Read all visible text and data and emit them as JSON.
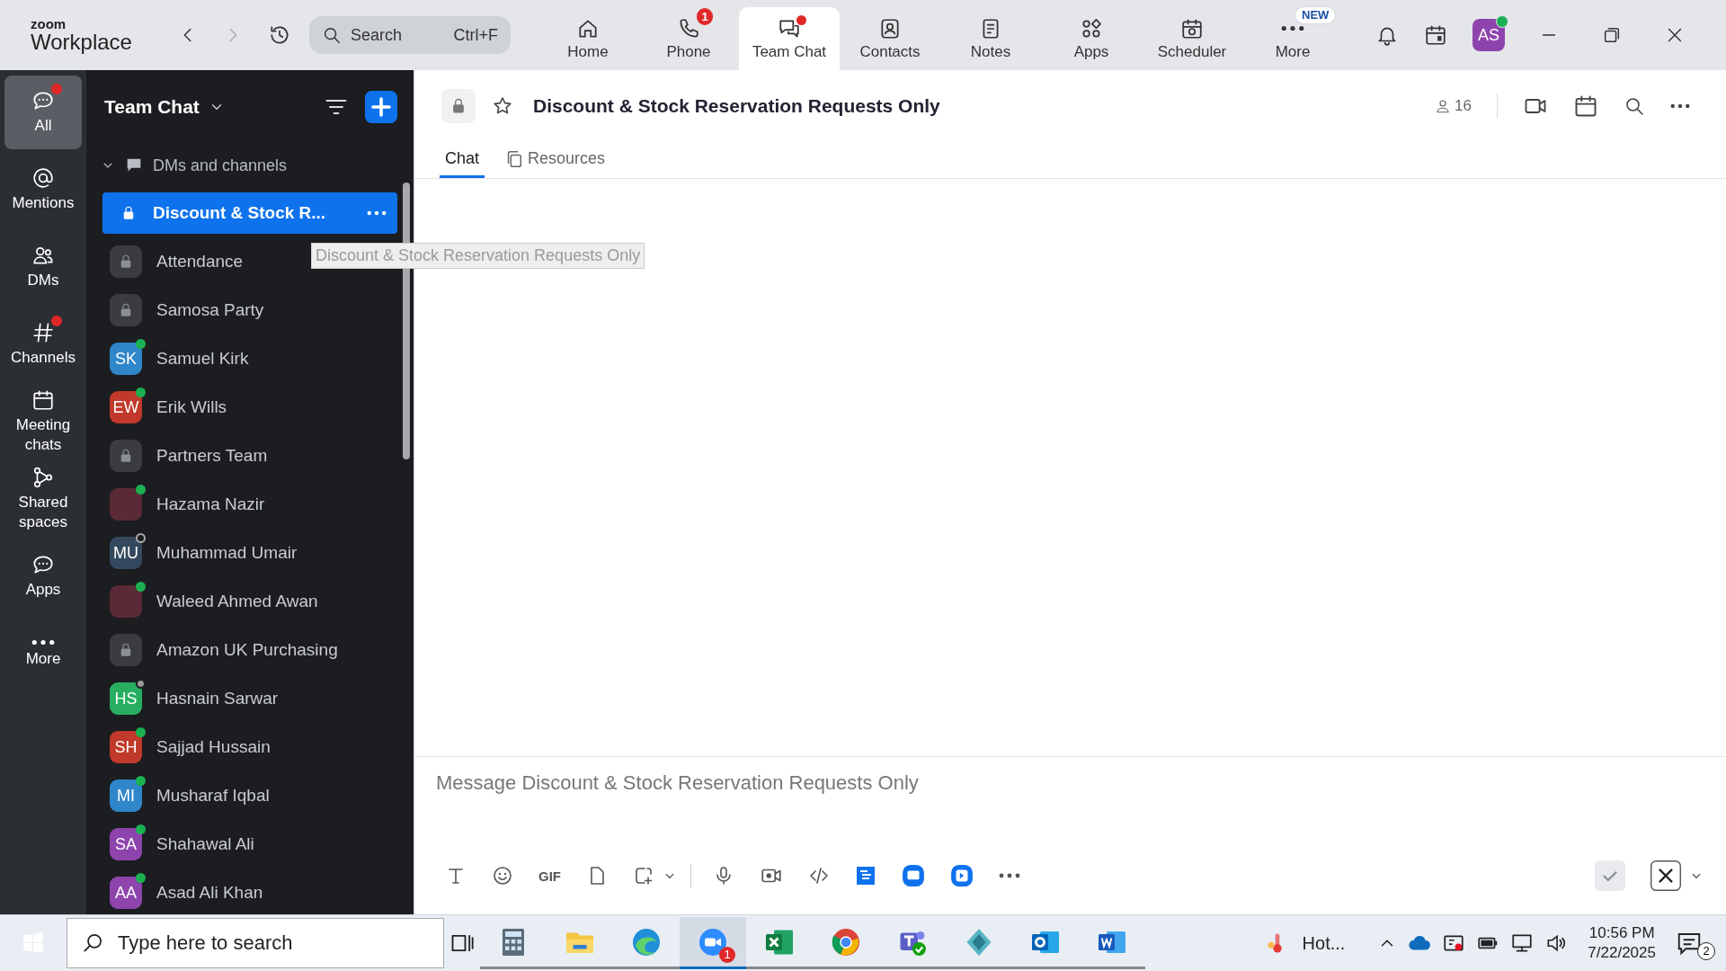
{
  "app_bar": {
    "logo_top": "zoom",
    "logo_bottom": "Workplace",
    "search": {
      "placeholder": "Search",
      "shortcut": "Ctrl+F"
    },
    "nav": [
      {
        "label": "Home",
        "selected": false
      },
      {
        "label": "Phone",
        "selected": false,
        "badge": "1"
      },
      {
        "label": "Team Chat",
        "selected": true,
        "dot": true
      },
      {
        "label": "Contacts",
        "selected": false
      },
      {
        "label": "Notes",
        "selected": false
      },
      {
        "label": "Apps",
        "selected": false
      },
      {
        "label": "Scheduler",
        "selected": false
      },
      {
        "label": "More",
        "selected": false,
        "tag": "NEW"
      }
    ],
    "profile": {
      "initials": "AS",
      "color": "#8e44ad"
    }
  },
  "rail": [
    {
      "label": "All",
      "selected": true,
      "dot": true
    },
    {
      "label": "Mentions",
      "selected": false,
      "dot": false
    },
    {
      "label": "DMs",
      "selected": false,
      "dot": false
    },
    {
      "label": "Channels",
      "selected": false,
      "dot": true
    },
    {
      "label": "Meeting chats",
      "selected": false,
      "dot": false
    },
    {
      "label": "Shared spaces",
      "selected": false,
      "dot": false
    },
    {
      "label": "Apps",
      "selected": false,
      "dot": false
    },
    {
      "label": "More",
      "selected": false,
      "dot": false
    }
  ],
  "chat_list": {
    "title": "Team Chat",
    "section": "DMs and channels",
    "expanded": true,
    "items": [
      {
        "name": "Discount & Stock R...",
        "kind": "channel",
        "selected": true
      },
      {
        "name": "Attendance",
        "kind": "channel",
        "selected": false
      },
      {
        "name": "Samosa Party",
        "kind": "channel",
        "selected": false
      },
      {
        "name": "Samuel Kirk",
        "kind": "person",
        "initials": "SK",
        "color": "#2f86c9",
        "online": true,
        "away": false,
        "selected": false
      },
      {
        "name": "Erik Wills",
        "kind": "person",
        "initials": "EW",
        "color": "#c0392b",
        "online": true,
        "away": false,
        "selected": false
      },
      {
        "name": "Partners Team",
        "kind": "channel",
        "selected": false
      },
      {
        "name": "Hazama Nazir",
        "kind": "photo",
        "online": true,
        "away": false,
        "selected": false
      },
      {
        "name": "Muhammad Umair",
        "kind": "person",
        "initials": "MU",
        "color": "#34495e",
        "online": false,
        "away": false,
        "selected": false
      },
      {
        "name": "Waleed Ahmed Awan",
        "kind": "photo",
        "online": true,
        "away": false,
        "selected": false
      },
      {
        "name": "Amazon UK Purchasing",
        "kind": "channel",
        "selected": false
      },
      {
        "name": "Hasnain Sarwar",
        "kind": "person",
        "initials": "HS",
        "color": "#27ae60",
        "online": false,
        "away": true,
        "selected": false
      },
      {
        "name": "Sajjad Hussain",
        "kind": "person",
        "initials": "SH",
        "color": "#c0392b",
        "online": true,
        "away": false,
        "selected": false
      },
      {
        "name": "Musharaf Iqbal",
        "kind": "person",
        "initials": "MI",
        "color": "#2f86c9",
        "online": true,
        "away": false,
        "selected": false
      },
      {
        "name": "Shahawal Ali",
        "kind": "person",
        "initials": "SA",
        "color": "#8e44ad",
        "online": true,
        "away": false,
        "selected": false
      },
      {
        "name": "Asad Ali Khan",
        "kind": "person",
        "initials": "AA",
        "color": "#8e44ad",
        "online": true,
        "away": false,
        "selected": false
      }
    ],
    "tooltip": "Discount & Stock Reservation Requests Only"
  },
  "channel": {
    "title": "Discount & Stock Reservation Requests Only",
    "members": "16",
    "tabs": [
      {
        "label": "Chat",
        "selected": true
      },
      {
        "label": "Resources",
        "selected": false
      }
    ],
    "composer": {
      "placeholder": "Message Discount & Stock Reservation Requests Only",
      "gif": "GIF"
    }
  },
  "taskbar": {
    "search_placeholder": "Type here to search",
    "zoom_badge": "1",
    "weather": "Hot...",
    "time": "10:56 PM",
    "date": "7/22/2025",
    "notifications": "2"
  }
}
